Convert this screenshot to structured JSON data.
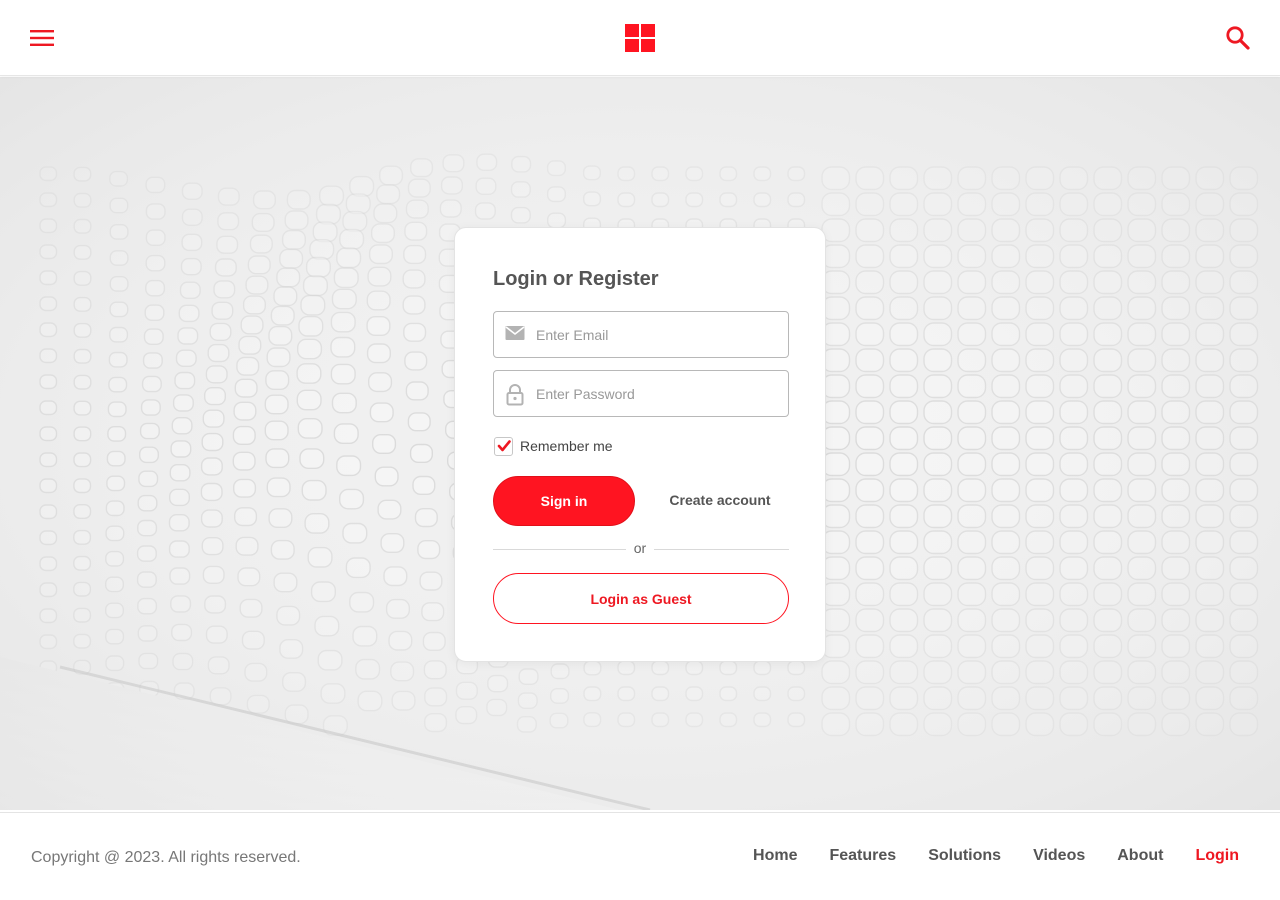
{
  "header": {
    "menu_icon": "hamburger-menu-icon",
    "logo_icon": "windows-grid-logo",
    "search_icon": "search-icon"
  },
  "login_card": {
    "title": "Login or Register",
    "email": {
      "value": "",
      "placeholder": "Enter Email",
      "icon": "envelope-icon"
    },
    "password": {
      "value": "",
      "placeholder": "Enter Password",
      "icon": "lock-icon"
    },
    "remember_label": "Remember me",
    "remember_checked": true,
    "signin_label": "Sign in",
    "create_account_label": "Create account",
    "divider_text": "or",
    "guest_label": "Login as Guest"
  },
  "footer": {
    "copyright": "Copyright @ 2023. All rights reserved.",
    "nav": [
      {
        "label": "Home",
        "active": false
      },
      {
        "label": "Features",
        "active": false
      },
      {
        "label": "Solutions",
        "active": false
      },
      {
        "label": "Videos",
        "active": false
      },
      {
        "label": "About",
        "active": false
      },
      {
        "label": "Login",
        "active": true
      }
    ]
  },
  "colors": {
    "accent": "#ff1421",
    "accent_text": "#ee1822",
    "text_dark": "#555555",
    "field_border": "#b8b8b8"
  }
}
